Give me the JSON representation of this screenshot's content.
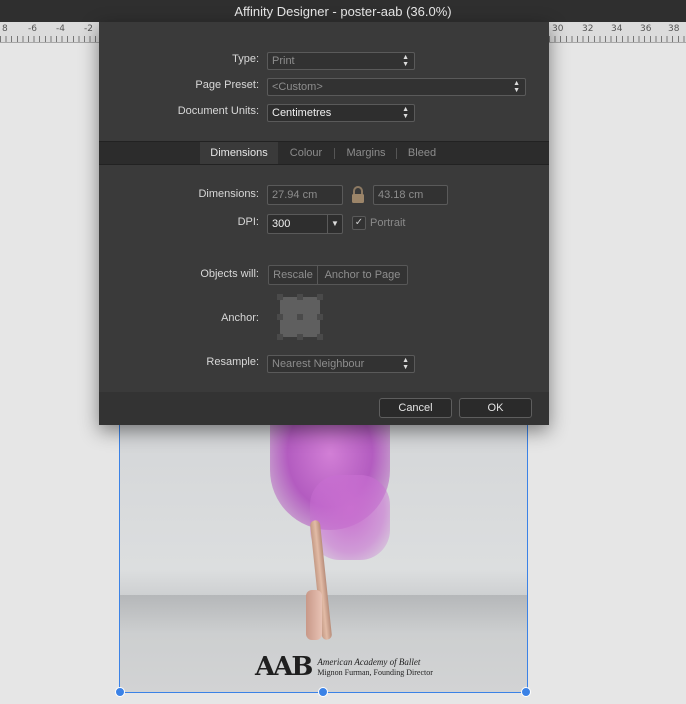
{
  "window": {
    "title": "Affinity Designer - poster-aab (36.0%)"
  },
  "rulers": {
    "left_labels": [
      "8",
      "-6",
      "-4",
      "-2"
    ],
    "right_labels": [
      "30",
      "32",
      "34",
      "36",
      "38"
    ]
  },
  "dialog": {
    "type": {
      "label": "Type:",
      "value": "Print"
    },
    "page_preset": {
      "label": "Page Preset:",
      "value": "<Custom>"
    },
    "document_units": {
      "label": "Document Units:",
      "value": "Centimetres"
    },
    "tabs": [
      {
        "label": "Dimensions"
      },
      {
        "label": "Colour"
      },
      {
        "label": "Margins"
      },
      {
        "label": "Bleed"
      }
    ],
    "dimensions": {
      "label": "Dimensions:",
      "width": "27.94 cm",
      "height": "43.18 cm"
    },
    "dpi": {
      "label": "DPI:",
      "value": "300"
    },
    "portrait": {
      "label": "Portrait",
      "checked": true
    },
    "objects_will": {
      "label": "Objects will:",
      "options": [
        "Rescale",
        "Anchor to Page"
      ]
    },
    "anchor": {
      "label": "Anchor:"
    },
    "resample": {
      "label": "Resample:",
      "value": "Nearest Neighbour"
    },
    "buttons": {
      "cancel": "Cancel",
      "ok": "OK"
    }
  },
  "poster": {
    "logo_main": "AAB",
    "logo_line1": "American Academy of Ballet",
    "logo_line2": "Mignon Furman, Founding Director"
  },
  "colors": {
    "selection": "#3b82e6",
    "dialog_bg": "#3a3a3a"
  }
}
